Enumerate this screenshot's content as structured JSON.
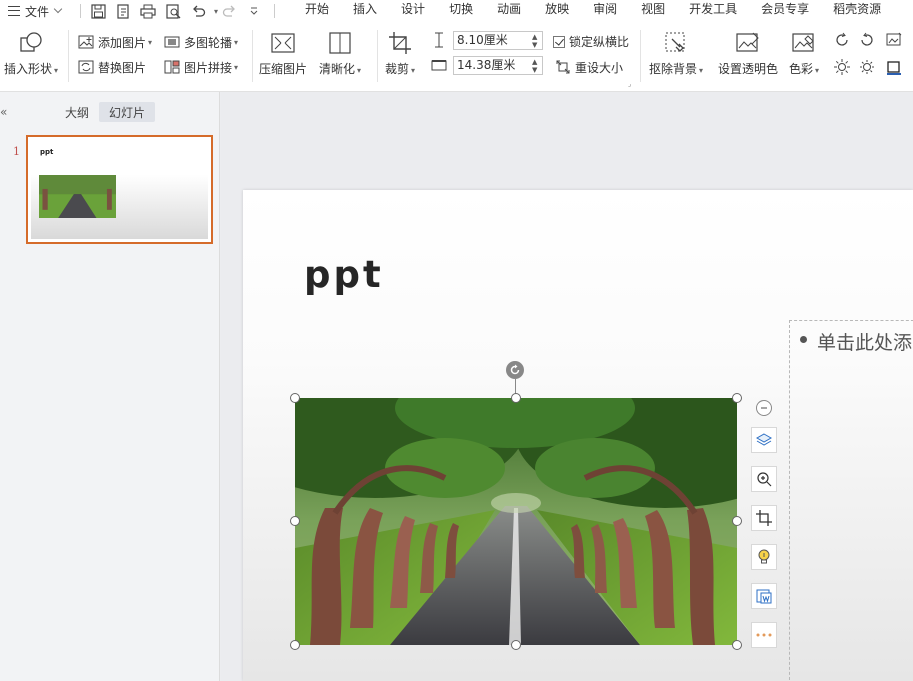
{
  "menubar": {
    "file_label": "文件",
    "tabs": [
      "开始",
      "插入",
      "设计",
      "切换",
      "动画",
      "放映",
      "审阅",
      "视图",
      "开发工具",
      "会员专享",
      "稻壳资源"
    ]
  },
  "ribbon": {
    "insert_shape": "插入形状",
    "add_picture": "添加图片",
    "replace_picture": "替换图片",
    "multi_carousel": "多图轮播",
    "picture_mosaic": "图片拼接",
    "compress_picture": "压缩图片",
    "clarify": "清晰化",
    "crop": "裁剪",
    "height_value": "8.10厘米",
    "width_value": "14.38厘米",
    "lock_aspect": "锁定纵横比",
    "reset_size": "重设大小",
    "remove_bg": "抠除背景",
    "set_transparent": "设置透明色",
    "color": "色彩"
  },
  "leftpanel": {
    "collapse": "«",
    "tab_outline": "大纲",
    "tab_slides": "幻灯片",
    "slide_number": "1",
    "thumb_title": "ppt"
  },
  "slide": {
    "title": "ppt",
    "placeholder": "单击此处添"
  }
}
